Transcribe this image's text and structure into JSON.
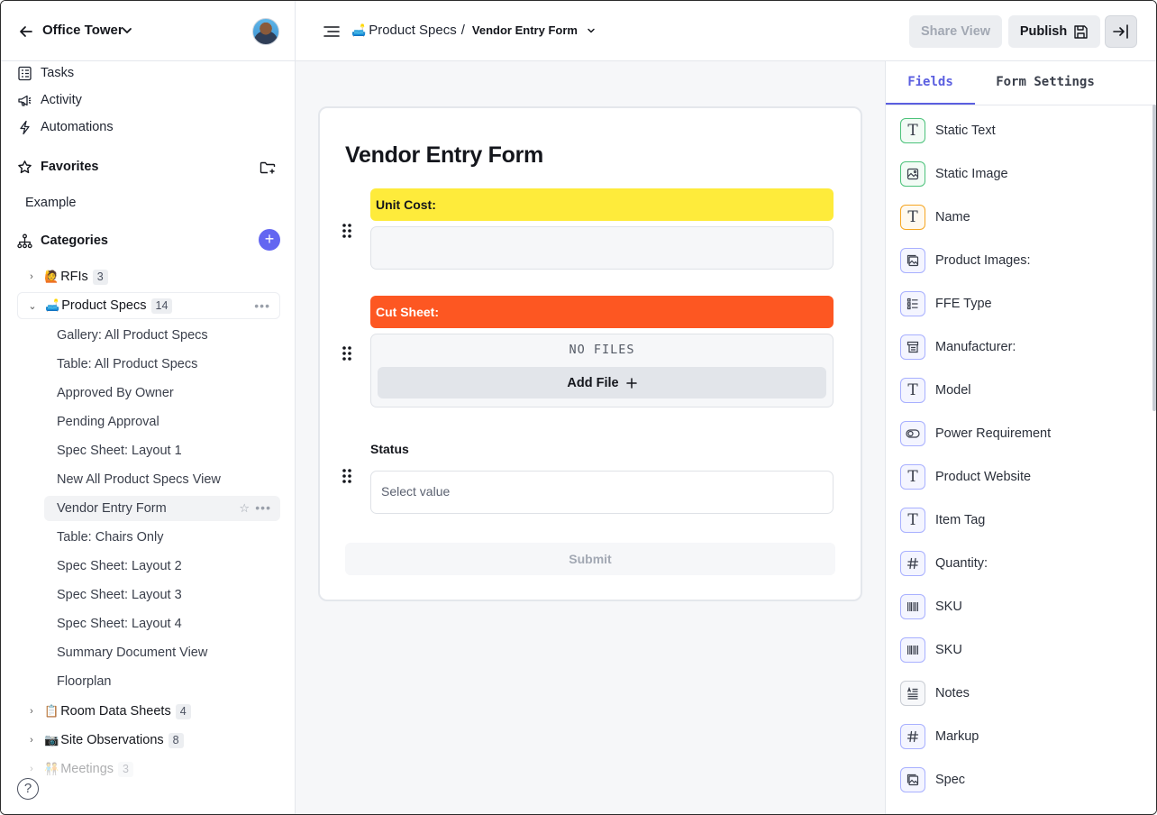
{
  "sidebar": {
    "workspace": "Office Tower",
    "nav": [
      {
        "label": "Tasks",
        "icon": "tasks-icon"
      },
      {
        "label": "Activity",
        "icon": "megaphone-icon"
      },
      {
        "label": "Automations",
        "icon": "lightning-icon"
      }
    ],
    "favorites_label": "Favorites",
    "favorites_items": [
      "Example"
    ],
    "categories_label": "Categories",
    "categories": [
      {
        "emoji": "🙋",
        "label": "RFIs",
        "count": "3"
      },
      {
        "emoji": "🛋️",
        "label": "Product Specs",
        "count": "14"
      },
      {
        "emoji": "📋",
        "label": "Room Data Sheets",
        "count": "4"
      },
      {
        "emoji": "📷",
        "label": "Site Observations",
        "count": "8"
      },
      {
        "emoji": "🧑‍🤝‍🧑",
        "label": "Meetings",
        "count": "3"
      }
    ],
    "product_spec_views": [
      "Gallery: All Product Specs",
      "Table: All Product Specs",
      "Approved By Owner",
      "Pending Approval",
      "Spec Sheet: Layout 1",
      "New All Product Specs View",
      "Vendor Entry Form",
      "Table: Chairs Only",
      "Spec Sheet: Layout 2",
      "Spec Sheet: Layout 3",
      "Spec Sheet: Layout 4",
      "Summary Document View",
      "Floorplan"
    ],
    "help_label": "?"
  },
  "topbar": {
    "breadcrumb_emoji": "🛋️",
    "breadcrumb_parent": "Product Specs",
    "breadcrumb_separator": "/",
    "breadcrumb_current": "Vendor Entry Form",
    "share_label": "Share View",
    "publish_label": "Publish"
  },
  "form": {
    "title": "Vendor Entry Form",
    "fields": [
      {
        "label": "Unit Cost:",
        "color": "#feeb3b"
      },
      {
        "label": "Cut Sheet:",
        "color": "#fd5722"
      }
    ],
    "no_files_text": "NO FILES",
    "add_file_label": "Add File",
    "status_label": "Status",
    "status_placeholder": "Select value",
    "submit_label": "Submit"
  },
  "panel": {
    "tabs": [
      "Fields",
      "Form Settings"
    ],
    "fields": [
      {
        "label": "Static Text",
        "icon": "text-icon"
      },
      {
        "label": "Static Image",
        "icon": "image-icon"
      },
      {
        "label": "Name",
        "icon": "text-icon"
      },
      {
        "label": "Product Images:",
        "icon": "gallery-icon"
      },
      {
        "label": "FFE Type",
        "icon": "list-icon"
      },
      {
        "label": "Manufacturer:",
        "icon": "stack-icon"
      },
      {
        "label": "Model",
        "icon": "text-icon"
      },
      {
        "label": "Power Requirement",
        "icon": "toggle-icon"
      },
      {
        "label": "Product Website",
        "icon": "text-icon"
      },
      {
        "label": "Item Tag",
        "icon": "text-icon"
      },
      {
        "label": "Quantity:",
        "icon": "hash-icon"
      },
      {
        "label": "SKU",
        "icon": "barcode-icon"
      },
      {
        "label": "SKU",
        "icon": "barcode-icon"
      },
      {
        "label": "Notes",
        "icon": "notes-icon"
      },
      {
        "label": "Markup",
        "icon": "hash-icon"
      },
      {
        "label": "Spec",
        "icon": "gallery-icon"
      }
    ]
  },
  "colors": {
    "accent": "#6366f1",
    "tab_active": "#5b5fe0",
    "unit_cost_bar": "#feeb3b",
    "cut_sheet_bar": "#fd5722"
  }
}
